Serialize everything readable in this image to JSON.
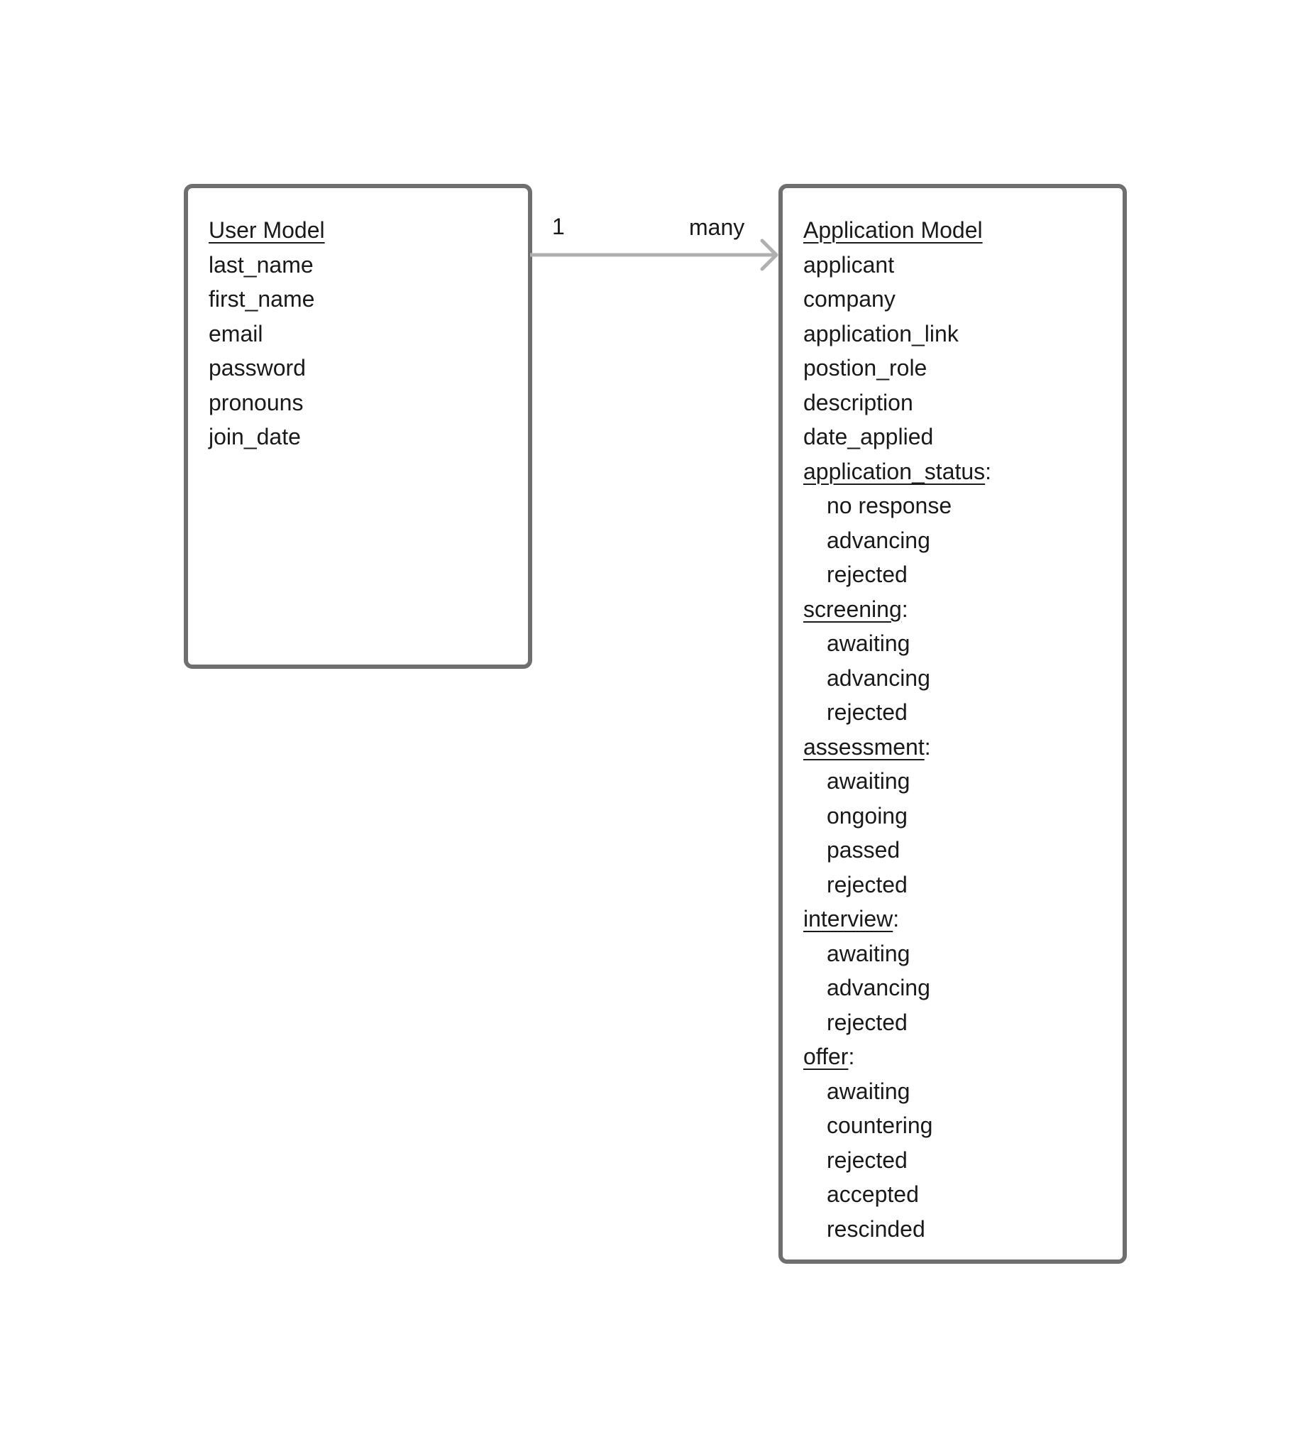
{
  "user_model": {
    "title": "User Model",
    "fields": [
      "last_name",
      "first_name",
      "email",
      "password",
      "pronouns",
      "join_date"
    ]
  },
  "relationship": {
    "source_cardinality": "1",
    "target_cardinality": "many"
  },
  "application_model": {
    "title": "Application Model",
    "fields": [
      "applicant",
      "company",
      "application_link",
      "postion_role",
      "description",
      "date_applied"
    ],
    "status_groups": [
      {
        "name": "application_status",
        "options": [
          "no response",
          "advancing",
          "rejected"
        ]
      },
      {
        "name": "screening",
        "options": [
          "awaiting",
          "advancing",
          "rejected"
        ]
      },
      {
        "name": "assessment",
        "options": [
          "awaiting",
          "ongoing",
          "passed",
          "rejected"
        ]
      },
      {
        "name": "interview",
        "options": [
          "awaiting",
          "advancing",
          "rejected"
        ]
      },
      {
        "name": "offer",
        "options": [
          "awaiting",
          "countering",
          "rejected",
          "accepted",
          "rescinded"
        ]
      }
    ]
  },
  "colors": {
    "box_border": "#6f6f6f",
    "connector": "#b0b0b0",
    "text": "#1a1a1a"
  }
}
